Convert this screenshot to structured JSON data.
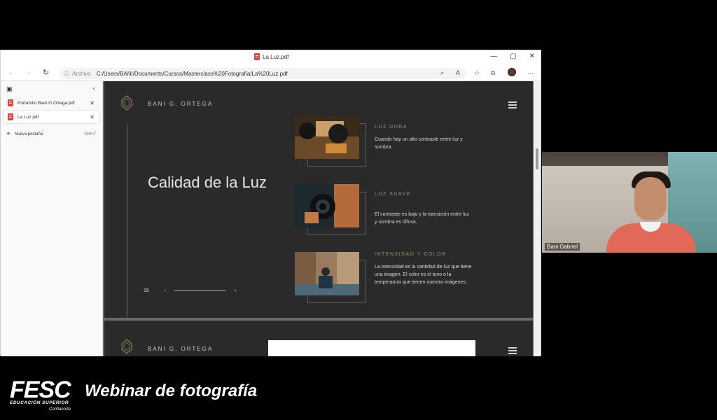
{
  "browser": {
    "tab_title": "La Luz.pdf",
    "window_controls": [
      "—",
      "▢",
      "✕"
    ],
    "address": {
      "archivo_label": "Archivo",
      "url": "C:/Users/BANI/Documents/Cursos/Masterclass%20Fotografía/La%20Luz.pdf"
    }
  },
  "sidebar": {
    "items": [
      {
        "label": "Portafolio Bani G Ortega.pdf",
        "close": "✕"
      },
      {
        "label": "La Luz.pdf",
        "close": "✕"
      }
    ],
    "new_tab": {
      "label": "Nueva pestaña",
      "shortcut": "Ctrl+T"
    }
  },
  "pdf": {
    "brand": "BANI G. ORTEGA",
    "title": "Calidad de la Luz",
    "page_number": "15",
    "items": [
      {
        "title": "LUZ DURA",
        "desc": "Cuando hay un alto contraste entre luz y sombra."
      },
      {
        "title": "LUZ SUAVE",
        "desc": "El contraste es bajo y la transición entre luz y sombra es difusa."
      },
      {
        "title": "INTENSIDAD Y COLOR",
        "desc": "La intensidad es la cantidad de luz que tiene una imagen. El color es el tono o la temperatura que tienen nuestra imágenes."
      }
    ],
    "page2_brand": "BANI G. ORTEGA"
  },
  "webcam": {
    "name": "Bani Gabriel"
  },
  "footer": {
    "logo": "FESC",
    "logo_sub": "EDUCACIÓN SUPERIOR",
    "logo_sub2": "Confianorte",
    "title": "Webinar de fotografía"
  }
}
